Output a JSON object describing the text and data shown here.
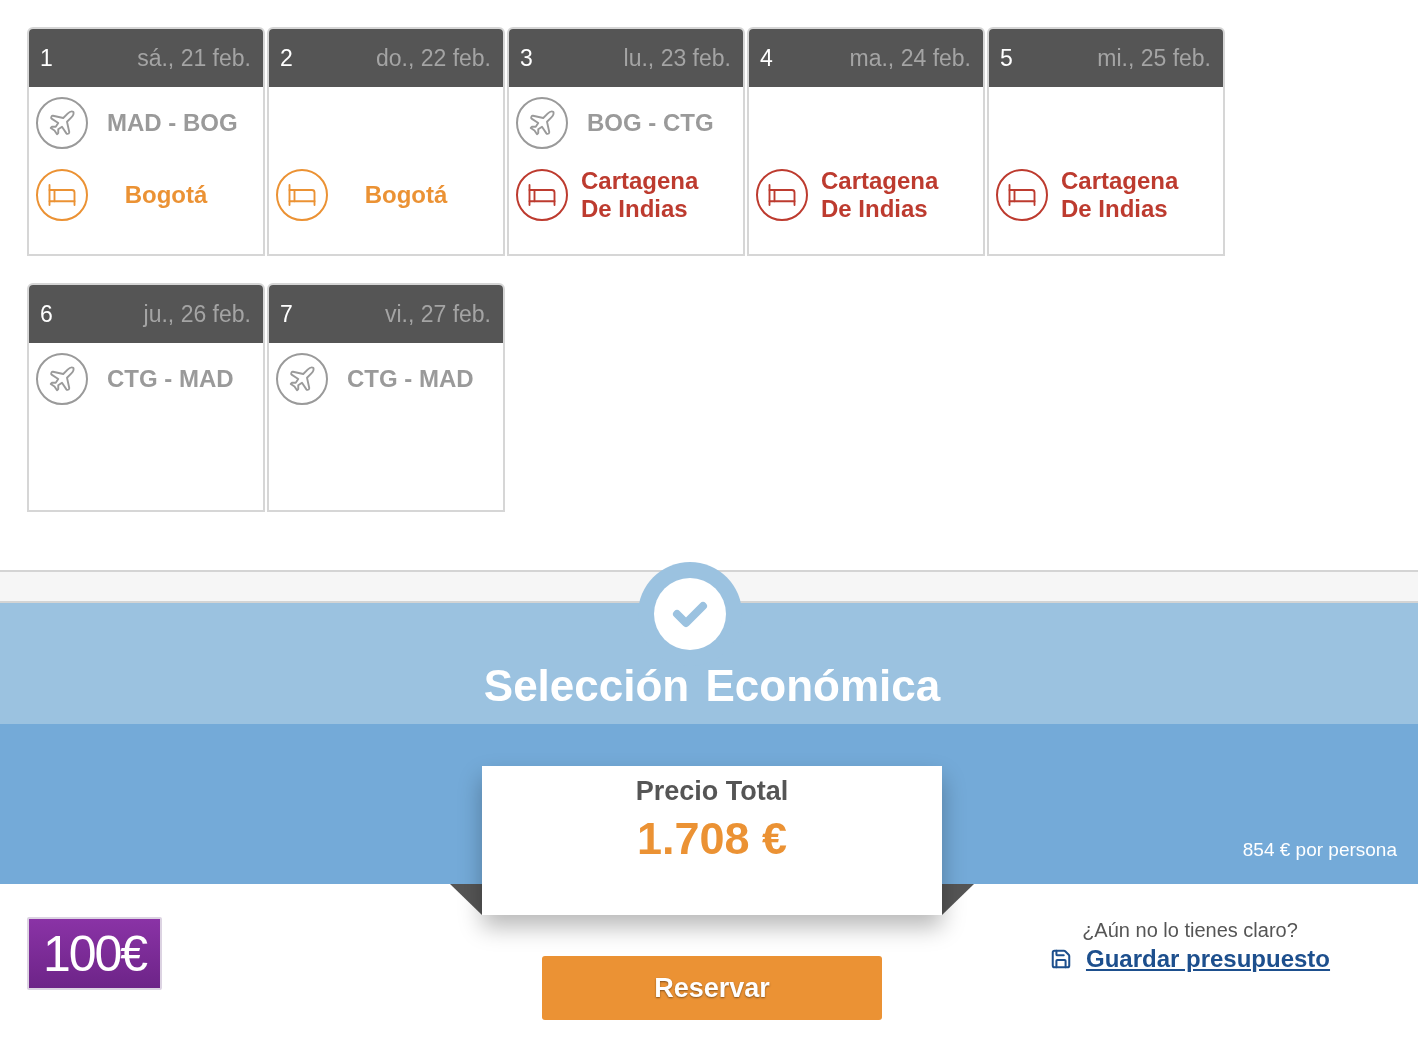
{
  "itinerary": {
    "days": [
      {
        "number": "1",
        "date": "sá., 21 feb.",
        "flight": {
          "route": "MAD - BOG"
        },
        "stay": {
          "city": "Bogotá",
          "color": "#eb9234"
        }
      },
      {
        "number": "2",
        "date": "do., 22 feb.",
        "stay": {
          "city": "Bogotá",
          "color": "#eb9234"
        }
      },
      {
        "number": "3",
        "date": "lu., 23 feb.",
        "flight": {
          "route": "BOG - CTG"
        },
        "stay": {
          "city": "Cartagena De Indias",
          "color": "#bd3b2f"
        }
      },
      {
        "number": "4",
        "date": "ma., 24 feb.",
        "stay": {
          "city": "Cartagena De Indias",
          "color": "#bd3b2f"
        }
      },
      {
        "number": "5",
        "date": "mi., 25 feb.",
        "stay": {
          "city": "Cartagena De Indias",
          "color": "#bd3b2f"
        }
      },
      {
        "number": "6",
        "date": "ju., 26 feb.",
        "flight": {
          "route": "CTG - MAD"
        }
      },
      {
        "number": "7",
        "date": "vi., 27 feb.",
        "flight": {
          "route": "CTG - MAD"
        }
      }
    ]
  },
  "package": {
    "title": "Selección Económica",
    "price_label": "Precio Total",
    "total_price": "1.708 €",
    "per_person": "854 € por persona"
  },
  "promo_badge": {
    "text": "100€"
  },
  "book_button": {
    "label": "Reservar"
  },
  "save_prompt": {
    "question": "¿Aún no lo tienes claro?",
    "link": "Guardar presupuesto"
  }
}
